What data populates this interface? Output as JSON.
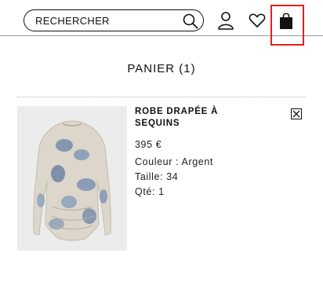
{
  "header": {
    "search": {
      "placeholder": "RECHERCHER"
    },
    "icons": [
      "search-icon",
      "account-icon",
      "heart-icon",
      "shopping-bag-icon"
    ]
  },
  "cart": {
    "title": "PANIER (1)",
    "items": [
      {
        "name": "ROBE DRAPÉE À SEQUINS",
        "price": "395 €",
        "color_label": "Couleur : ",
        "color": "Argent",
        "size_label": "Taille: ",
        "size": "34",
        "qty_label": "Qté: ",
        "qty": "1"
      }
    ]
  },
  "colors": {
    "highlight": "#e02020",
    "text": "#111111",
    "image_background": "#ececec"
  }
}
